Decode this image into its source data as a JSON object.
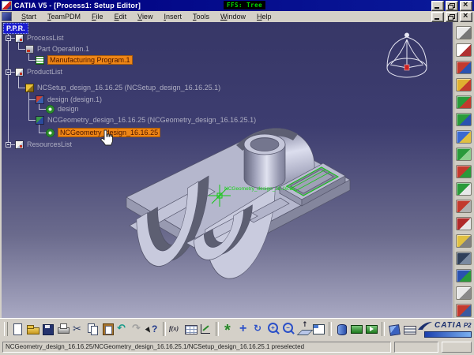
{
  "window": {
    "title": "CATIA V5 - [Process1: Setup Editor]",
    "overlay_badge": "FFS: Tree"
  },
  "menu": {
    "items": [
      "Start",
      "TeamPDM",
      "File",
      "Edit",
      "View",
      "Insert",
      "Tools",
      "Window",
      "Help"
    ]
  },
  "tree": {
    "root": "P.P.R.",
    "items": [
      {
        "label": "ProcessList",
        "level": 1,
        "icon": "process-list-icon",
        "iconType": "list",
        "style": "plain"
      },
      {
        "label": "Part Operation.1",
        "level": 2,
        "icon": "part-operation-icon",
        "iconType": "partop",
        "style": "plain"
      },
      {
        "label": "Manufacturing Program.1",
        "level": 3,
        "icon": "manufacturing-program-icon",
        "iconType": "mfg",
        "style": "orange"
      },
      {
        "label": "ProductList",
        "level": 1,
        "icon": "product-list-icon",
        "iconType": "list",
        "style": "plain"
      },
      {
        "label": "NCSetup_design_16.16.25 (NCSetup_design_16.16.25.1)",
        "level": 2,
        "icon": "ncsetup-icon",
        "iconType": "ncsetup",
        "style": "plain"
      },
      {
        "label": "design (design.1)",
        "level": 3,
        "icon": "design-node-icon",
        "iconType": "designnode",
        "style": "plain"
      },
      {
        "label": "design",
        "level": 4,
        "icon": "design-part-icon",
        "iconType": "gearleaf",
        "style": "plain"
      },
      {
        "label": "NCGeometry_design_16.16.25 (NCGeometry_design_16.16.25.1)",
        "level": 3,
        "icon": "ncgeometry-node-icon",
        "iconType": "ncgeomnode",
        "style": "plain"
      },
      {
        "label": "NCGeometry_design_16.16.25",
        "level": 4,
        "icon": "ncgeometry-part-icon",
        "iconType": "gearleaf",
        "style": "orange"
      },
      {
        "label": "ResourcesList",
        "level": 1,
        "icon": "resources-list-icon",
        "iconType": "list",
        "style": "plain"
      }
    ]
  },
  "viewport": {
    "model_label": "NCGeometry_design_16.16.25"
  },
  "bottom_toolbar": {
    "items": [
      "new-document",
      "open",
      "save",
      "print",
      "cut",
      "copy",
      "paste",
      "undo",
      "redo",
      "whats-this",
      "|",
      "formula",
      "design-table",
      "measure",
      "|",
      "fit-all-in",
      "pan",
      "rotate",
      "zoom-in",
      "zoom-out",
      "normal-view",
      "multi-view",
      "|",
      "hide-show",
      "swap-visible-space",
      "swap-visible-space-2",
      "|",
      "shading",
      "render-style"
    ]
  },
  "right_toolbar": {
    "icons": [
      {
        "name": "sketcher-icon",
        "c1": "#e8e8e8",
        "c2": "#777777"
      },
      {
        "name": "select-icon",
        "c1": "#ffffff",
        "c2": "#b03030"
      },
      {
        "name": "pocketing-icon",
        "c1": "#c23a2e",
        "c2": "#2a52b0"
      },
      {
        "name": "facing-icon",
        "c1": "#e0b030",
        "c2": "#c23a2e"
      },
      {
        "name": "profile-contouring-icon",
        "c1": "#2a9a3a",
        "c2": "#c23a2e"
      },
      {
        "name": "drilling-icon",
        "c1": "#2a9a3a",
        "c2": "#2a52b0"
      },
      {
        "name": "roughing-icon",
        "c1": "#3a6ad0",
        "c2": "#e0c040"
      },
      {
        "name": "sweeping-icon",
        "c1": "#2a9a3a",
        "c2": "#8fd08f"
      },
      {
        "name": "pencil-operation-icon",
        "c1": "#c23a2e",
        "c2": "#2a9a3a"
      },
      {
        "name": "tool-change-icon",
        "c1": "#2a9a3a",
        "c2": "#e8e8e8"
      },
      {
        "name": "machine-simulation-icon",
        "c1": "#c23a2e",
        "c2": "#b0b0b0"
      },
      {
        "name": "tool-catalog-icon",
        "c1": "#b02a2a",
        "c2": "#e8e8e8"
      },
      {
        "name": "auxiliary-commands-icon",
        "c1": "#e0c040",
        "c2": "#808080"
      },
      {
        "name": "video-simulation-icon",
        "c1": "#30405a",
        "c2": "#7a8aa0"
      },
      {
        "name": "analysis-icon",
        "c1": "#2a52b0",
        "c2": "#2a9a3a"
      },
      {
        "name": "documentation-icon",
        "c1": "#e8e8e8",
        "c2": "#8a8a8a"
      },
      {
        "name": "resource-icon",
        "c1": "#c23a2e",
        "c2": "#3a5aa0"
      },
      {
        "name": "options-icon",
        "c1": "#9a9aa8",
        "c2": "#5a5a66"
      }
    ]
  },
  "logo": {
    "brand": "CATIA",
    "edition": "P2"
  },
  "status_bar": {
    "message": "NCGeometry_design_16.16.25/NCGeometry_design_16.16.25.1/NCSetup_design_16.16.25.1 preselected"
  },
  "colors": {
    "titlebar": "#000080",
    "selection_blue": "#1c1cce",
    "highlight_orange": "#ef8616",
    "highlight_green": "#15c815",
    "viewport_top": "#373767",
    "viewport_bottom": "#a9a9c3"
  }
}
